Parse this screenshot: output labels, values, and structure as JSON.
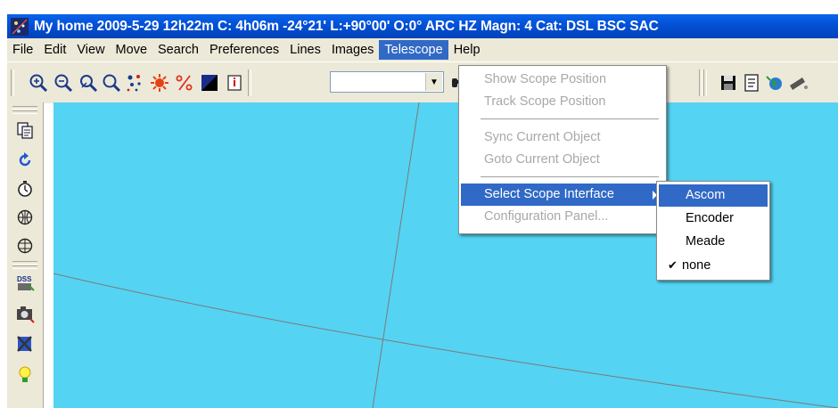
{
  "window": {
    "title": "My home 2009-5-29  12h22m C:  4h06m -24°21' L:+90°00' O:0° ARC HZ  Magn: 4 Cat: DSL BSC SAC"
  },
  "menubar": {
    "items": [
      "File",
      "Edit",
      "View",
      "Move",
      "Search",
      "Preferences",
      "Lines",
      "Images",
      "Telescope",
      "Help"
    ],
    "active": "Telescope"
  },
  "toolbar": {
    "search_combo_value": "",
    "icons": [
      "zoom-in-icon",
      "zoom-out-icon",
      "zoom-area-icon",
      "zoom-fit-icon",
      "stars-icon",
      "planet-icon",
      "percent-icon",
      "black-white-icon",
      "info-icon",
      "find-binoculars-icon",
      "save-icon",
      "notes-icon",
      "globe-icon",
      "telescope-icon"
    ]
  },
  "left_toolbar": {
    "icons": [
      "copy-icon",
      "refresh-icon",
      "clock-icon",
      "grid-eq-icon",
      "grid-alt-icon",
      "dss-icon",
      "camera-icon",
      "image-x-icon",
      "lamp-icon"
    ]
  },
  "telescope_menu": {
    "items": [
      {
        "label": "Show Scope Position",
        "enabled": false
      },
      {
        "label": "Track Scope Position",
        "enabled": false
      },
      {
        "label": "Sync Current Object",
        "enabled": false
      },
      {
        "label": "Goto Current Object",
        "enabled": false
      },
      {
        "label": "Select Scope Interface",
        "enabled": true,
        "submenu": true
      },
      {
        "label": "Configuration Panel...",
        "enabled": false
      }
    ]
  },
  "scope_interface_submenu": {
    "items": [
      {
        "label": "Ascom",
        "checked": false,
        "highlighted": true
      },
      {
        "label": "Encoder",
        "checked": false
      },
      {
        "label": "Meade",
        "checked": false
      },
      {
        "label": "none",
        "checked": true
      }
    ],
    "check_glyph": "✔"
  },
  "colors": {
    "titlebar": "#0350d6",
    "menu_highlight": "#3169c6",
    "sky": "#55d3f3",
    "chrome": "#ece9d8"
  }
}
